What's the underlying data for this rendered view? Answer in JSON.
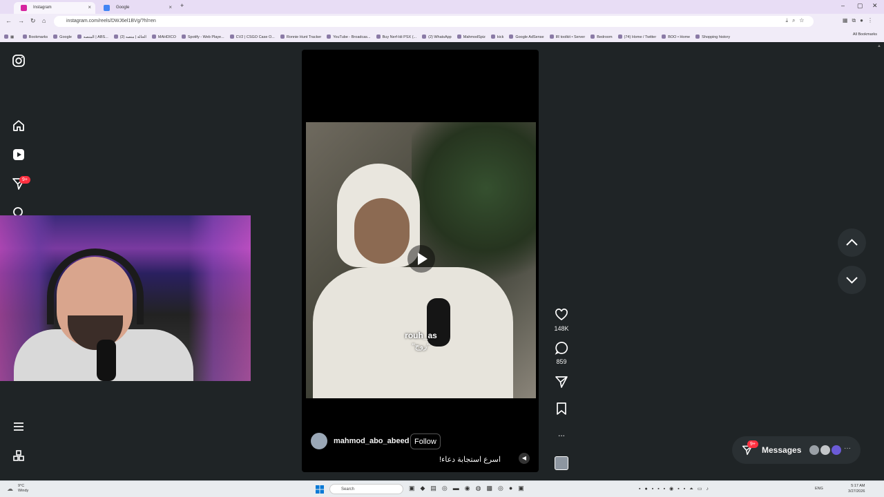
{
  "browser": {
    "tabs": [
      {
        "label": "Instagram",
        "favicon_color": "#d6249f"
      },
      {
        "label": "Google",
        "favicon_color": "#4285f4"
      }
    ],
    "new_tab_label": "+",
    "url": "instagram.com/reels/DWJ6el1BVg/?hl=en",
    "bookmarks": [
      "Bookmarks",
      "Google",
      "المنصه | ABS...",
      "(2) الحالة | منصه",
      "MAHDICO",
      "Spotify - Web Playe...",
      "CV2 | CSGO Case O...",
      "Ronnie Hunt Tracker",
      "YouTube - Broadcas...",
      "Buy Nerf-Idi PSX (...",
      "(2) WhatsApp",
      "MahmodSpiz",
      "kick",
      "Google AdSense",
      "IR toolkit • Server",
      "Bedroom",
      "(74) Home / Twitter",
      "BOO • Home",
      "Shopping history"
    ],
    "all_bookmarks": "All Bookmarks"
  },
  "sidebar": {
    "notifications_badge": "9+"
  },
  "reel": {
    "username": "mahmod_abo_abeed",
    "follow_label": "Follow",
    "caption": "اسرع استجابة دعاء!",
    "overlay_text_1": "rouh_as",
    "overlay_text_2": "\"روح\""
  },
  "actions": {
    "likes": "148K",
    "comments": "859",
    "more": "..."
  },
  "messages": {
    "label": "Messages",
    "badge": "9+"
  },
  "taskbar": {
    "weather_temp": "9°C",
    "weather_desc": "Windy",
    "search_placeholder": "Search",
    "lang": "ENG",
    "time": "5:17 AM",
    "date": "3/27/2026"
  }
}
